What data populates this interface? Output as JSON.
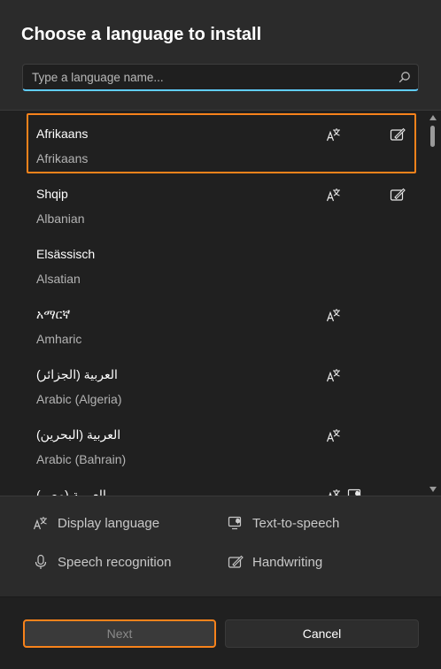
{
  "dialog": {
    "title": "Choose a language to install"
  },
  "search": {
    "placeholder": "Type a language name...",
    "icon": "search-icon"
  },
  "languages": [
    {
      "native": "Afrikaans",
      "english": "Afrikaans",
      "features": [
        "display-language",
        "handwriting"
      ],
      "selected": true
    },
    {
      "native": "Shqip",
      "english": "Albanian",
      "features": [
        "display-language",
        "handwriting"
      ],
      "selected": false
    },
    {
      "native": "Elsässisch",
      "english": "Alsatian",
      "features": [],
      "selected": false
    },
    {
      "native": "አማርኛ",
      "english": "Amharic",
      "features": [
        "display-language"
      ],
      "selected": false
    },
    {
      "native": "العربية (الجزائر)",
      "english": "Arabic (Algeria)",
      "features": [
        "display-language"
      ],
      "selected": false
    },
    {
      "native": "العربية (البحرين)",
      "english": "Arabic (Bahrain)",
      "features": [
        "display-language"
      ],
      "selected": false
    },
    {
      "native": "العربية (مصر)",
      "english": "",
      "features": [
        "display-language",
        "text-to-speech"
      ],
      "selected": false
    }
  ],
  "legend": {
    "display_language": "Display language",
    "text_to_speech": "Text-to-speech",
    "speech_recognition": "Speech recognition",
    "handwriting": "Handwriting"
  },
  "buttons": {
    "next": "Next",
    "cancel": "Cancel"
  },
  "colors": {
    "accent": "#60cdff",
    "focus_outline": "#f7821b",
    "background": "#2b2b2b",
    "list_background": "#202020"
  }
}
